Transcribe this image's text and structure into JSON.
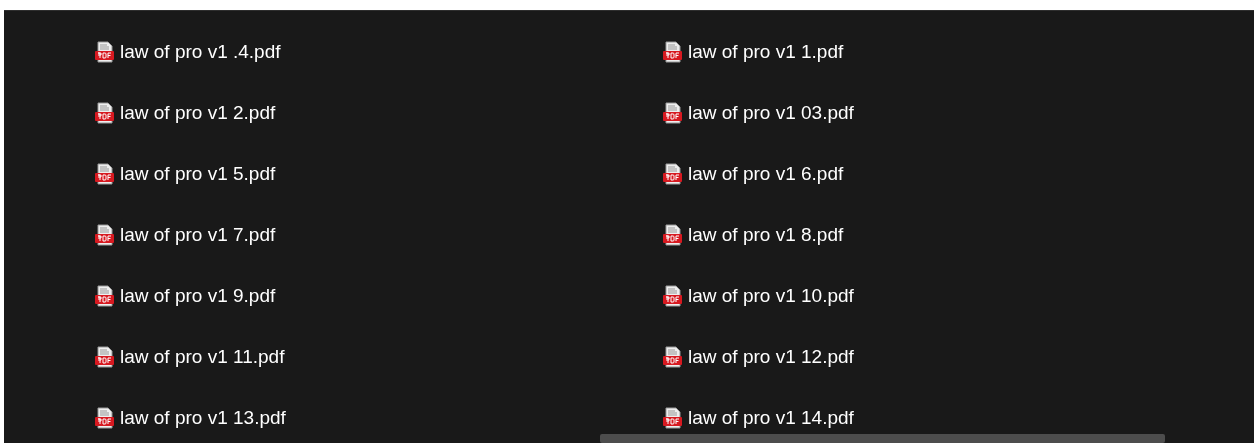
{
  "files": [
    {
      "name": "law of pro v1 .4.pdf"
    },
    {
      "name": "law of pro v1 1.pdf"
    },
    {
      "name": "law of pro v1 2.pdf"
    },
    {
      "name": "law of pro v1 03.pdf"
    },
    {
      "name": "law of pro v1 5.pdf"
    },
    {
      "name": "law of pro v1 6.pdf"
    },
    {
      "name": "law of pro v1 7.pdf"
    },
    {
      "name": "law of pro v1 8.pdf"
    },
    {
      "name": "law of pro v1 9.pdf"
    },
    {
      "name": "law of pro v1 10.pdf"
    },
    {
      "name": "law of pro v1 11.pdf"
    },
    {
      "name": "law of pro v1 12.pdf"
    },
    {
      "name": "law of pro v1 13.pdf"
    },
    {
      "name": "law of pro v1 14.pdf"
    }
  ]
}
